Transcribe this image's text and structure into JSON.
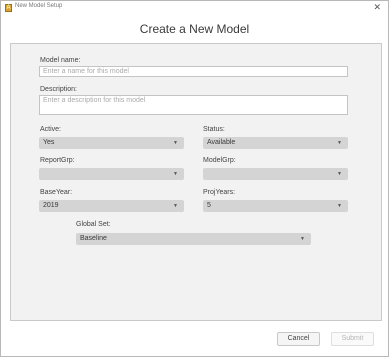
{
  "window": {
    "title": "New Model Setup",
    "close_glyph": "✕",
    "app_icon": "A"
  },
  "dialog": {
    "heading": "Create a New Model"
  },
  "model_name": {
    "label": "Model name:",
    "placeholder": "Enter a name for this model"
  },
  "description": {
    "label": "Description:",
    "placeholder": "Enter a description for this model"
  },
  "active": {
    "label": "Active:",
    "value": "Yes"
  },
  "status": {
    "label": "Status:",
    "value": "Available"
  },
  "report_grp": {
    "label": "ReportGrp:",
    "value": ""
  },
  "model_grp": {
    "label": "ModelGrp:",
    "value": ""
  },
  "base_year": {
    "label": "BaseYear:",
    "value": "2019"
  },
  "proj_years": {
    "label": "ProjYears:",
    "value": "5"
  },
  "global_set": {
    "label": "Global Set:",
    "value": "Baseline"
  },
  "buttons": {
    "cancel": "Cancel",
    "submit": "Submit"
  },
  "caret": "▼"
}
